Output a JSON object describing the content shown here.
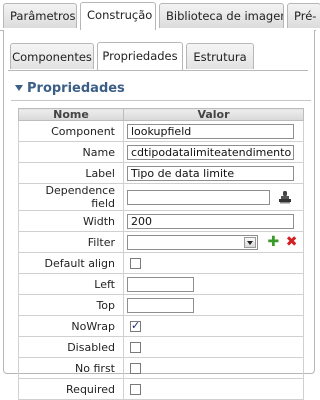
{
  "top_tabs": [
    "Parâmetros",
    "Construção",
    "Biblioteca de imagens",
    "Pré-"
  ],
  "inner_tabs": [
    "Componentes",
    "Propriedades",
    "Estrutura"
  ],
  "section_title": "Propriedades",
  "grid": {
    "col_name": "Nome",
    "col_value": "Valor",
    "rows": {
      "component": {
        "label": "Component",
        "value": "lookupfield"
      },
      "name": {
        "label": "Name",
        "value": "cdtipodatalimiteatendimento"
      },
      "label": {
        "label": "Label",
        "value": "Tipo de data limite"
      },
      "dependence_field": {
        "label": "Dependence field",
        "value": ""
      },
      "width": {
        "label": "Width",
        "value": "200"
      },
      "filter": {
        "label": "Filter",
        "value": ""
      },
      "default_align": {
        "label": "Default align",
        "checked": false
      },
      "left": {
        "label": "Left",
        "value": ""
      },
      "top": {
        "label": "Top",
        "value": ""
      },
      "nowrap": {
        "label": "NoWrap",
        "checked": true
      },
      "disabled": {
        "label": "Disabled",
        "checked": false
      },
      "no_first": {
        "label": "No first",
        "checked": false
      },
      "required": {
        "label": "Required",
        "checked": false
      }
    }
  },
  "icons": {
    "dependence_picker": "stamp-icon",
    "filter_add": "plus-icon",
    "filter_remove": "delete-icon"
  },
  "colors": {
    "section_title": "#3b5f86",
    "add": "#3a9a2a",
    "remove": "#d42020"
  }
}
